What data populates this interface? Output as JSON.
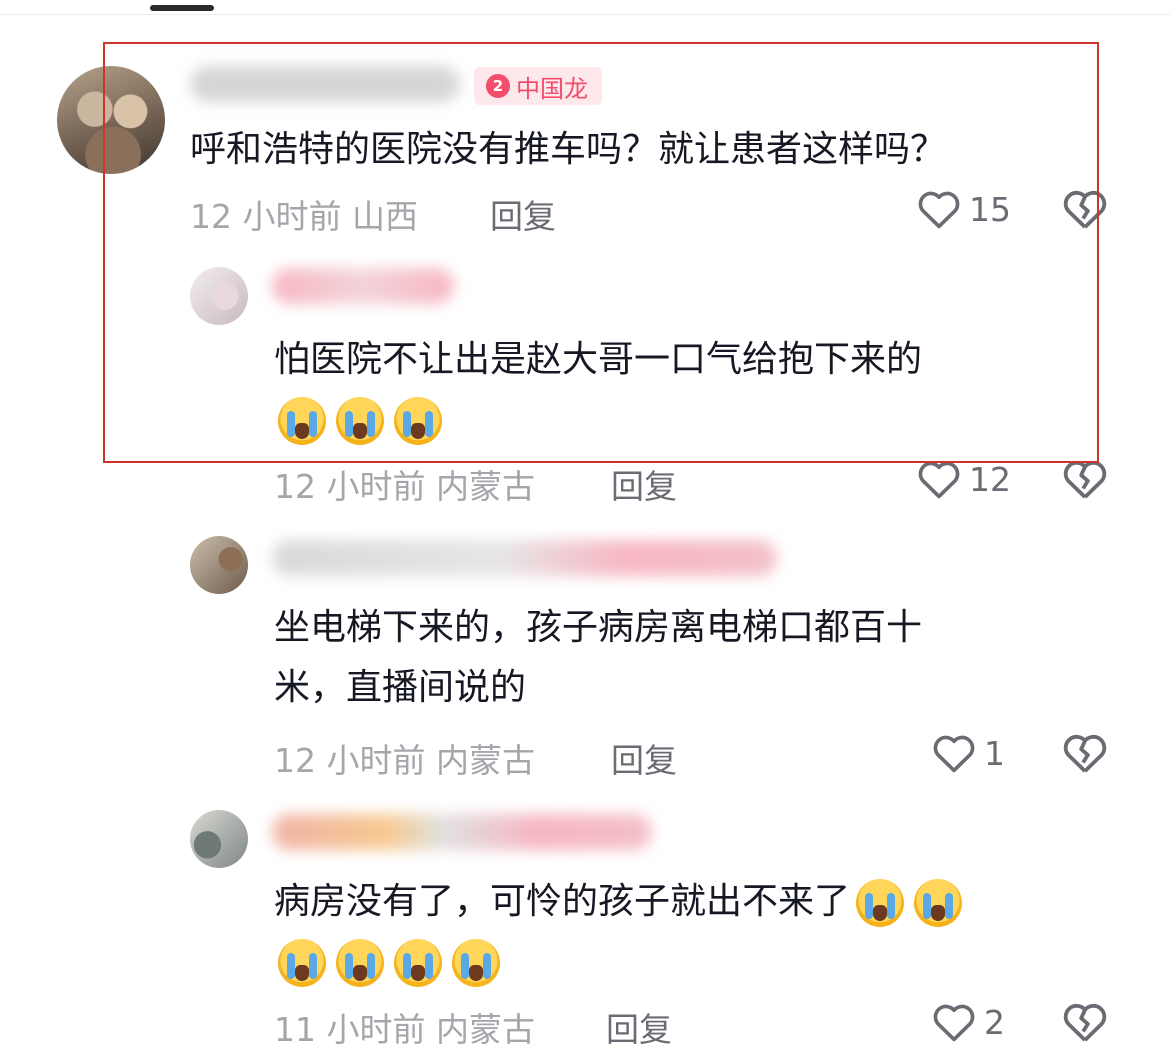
{
  "comments": [
    {
      "badge": {
        "level": "2",
        "label": "中国龙"
      },
      "text": "呼和浩特的医院没有推车吗？就让患者这样吗？",
      "time": "12 小时前",
      "location": "山西",
      "reply_label": "回复",
      "likes": "15"
    },
    {
      "text_lines": [
        "怕医院不让出是赵大哥一口气给抱下来的"
      ],
      "emoji_count": 3,
      "time": "12 小时前",
      "location": "内蒙古",
      "reply_label": "回复",
      "likes": "12"
    },
    {
      "text_lines": [
        "坐电梯下来的，孩子病房离电梯口都百十",
        "米，直播间说的"
      ],
      "time": "12 小时前",
      "location": "内蒙古",
      "reply_label": "回复",
      "likes": "1"
    },
    {
      "text_lines": [
        "病房没有了，可怜的孩子就出不来了"
      ],
      "emoji_count": 6,
      "time": "11 小时前",
      "location": "内蒙古",
      "reply_label": "回复",
      "likes": "2"
    }
  ],
  "icons": {
    "like": "heart-outline-icon",
    "dislike": "broken-heart-icon",
    "emoji": "loudly-crying-face-emoji"
  },
  "colors": {
    "highlight_box": "#d0332c",
    "badge": "#f24d6b",
    "meta": "#a5a6ab"
  }
}
